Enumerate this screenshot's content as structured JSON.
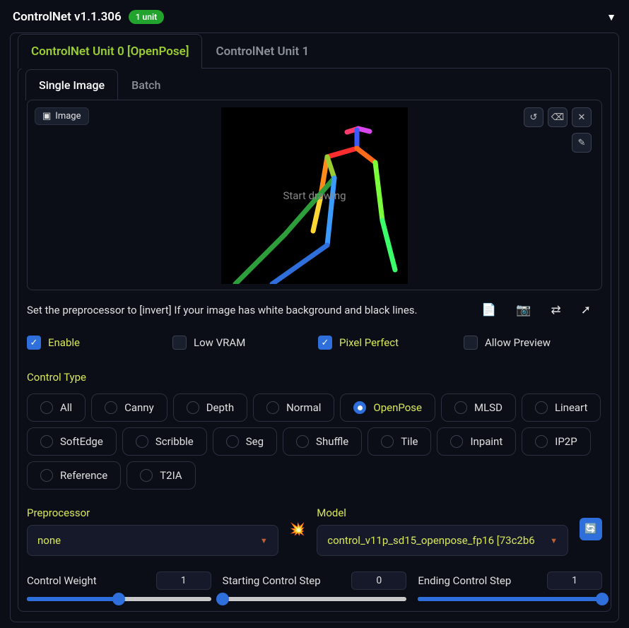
{
  "header": {
    "title": "ControlNet v1.1.306",
    "badge": "1 unit"
  },
  "unit_tabs": [
    {
      "label": "ControlNet Unit 0 [OpenPose]",
      "active": true
    },
    {
      "label": "ControlNet Unit 1",
      "active": false
    }
  ],
  "sub_tabs": [
    {
      "label": "Single Image",
      "active": true
    },
    {
      "label": "Batch",
      "active": false
    }
  ],
  "image": {
    "label": "Image",
    "overlay": "Start drawing"
  },
  "hint": "Set the preprocessor to [invert] If your image has white background and black lines.",
  "checks": {
    "enable": {
      "label": "Enable",
      "checked": true
    },
    "low_vram": {
      "label": "Low VRAM",
      "checked": false
    },
    "pixel_perfect": {
      "label": "Pixel Perfect",
      "checked": true
    },
    "allow_preview": {
      "label": "Allow Preview",
      "checked": false
    }
  },
  "control_type": {
    "label": "Control Type",
    "options": [
      "All",
      "Canny",
      "Depth",
      "Normal",
      "OpenPose",
      "MLSD",
      "Lineart",
      "SoftEdge",
      "Scribble",
      "Seg",
      "Shuffle",
      "Tile",
      "Inpaint",
      "IP2P",
      "Reference",
      "T2IA"
    ],
    "selected": "OpenPose"
  },
  "preprocessor": {
    "label": "Preprocessor",
    "value": "none"
  },
  "model": {
    "label": "Model",
    "value": "control_v11p_sd15_openpose_fp16 [73c2b6"
  },
  "sliders": {
    "control_weight": {
      "label": "Control Weight",
      "value": "1",
      "pct": 50
    },
    "start_step": {
      "label": "Starting Control Step",
      "value": "0",
      "pct": 0
    },
    "end_step": {
      "label": "Ending Control Step",
      "value": "1",
      "pct": 100
    }
  }
}
